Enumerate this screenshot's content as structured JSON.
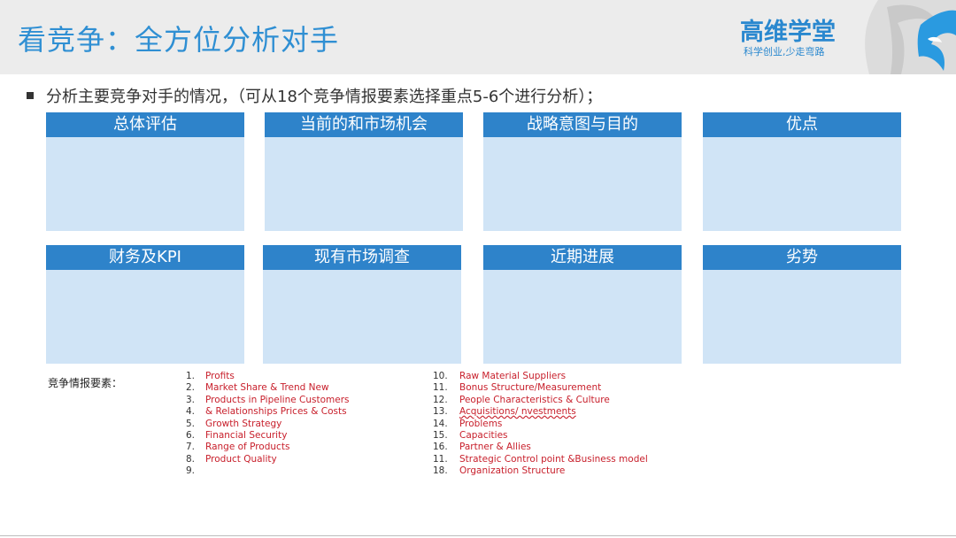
{
  "header": {
    "title": "看竞争：全方位分析对手",
    "brand": "高维学堂",
    "brand_tagline": "科学创业,少走弯路"
  },
  "intro": "分析主要竞争对手的情况，（可从18个竞争情报要素选择重点5-6个进行分析）；",
  "cards": [
    {
      "label": "总体评估"
    },
    {
      "label": "当前的和市场机会"
    },
    {
      "label": "战略意图与目的"
    },
    {
      "label": "优点"
    },
    {
      "label": "财务及KPI"
    },
    {
      "label": "现有市场调查"
    },
    {
      "label": "近期进展"
    },
    {
      "label": "劣势"
    }
  ],
  "factors": {
    "label": "竞争情报要素：",
    "column1": [
      {
        "num": "1.",
        "text": "Profits"
      },
      {
        "num": "2.",
        "text": "Market Share & Trend  New"
      },
      {
        "num": "3.",
        "text": "Products in Pipeline  Customers"
      },
      {
        "num": "4.",
        "text": "& Relationships  Prices & Costs"
      },
      {
        "num": "5.",
        "text": "Growth Strategy"
      },
      {
        "num": "6.",
        "text": "Financial Security"
      },
      {
        "num": "7.",
        "text": "Range of Products"
      },
      {
        "num": "8.",
        "text": "Product Quality"
      },
      {
        "num": "9.",
        "text": ""
      }
    ],
    "column2": [
      {
        "num": "10.",
        "text": "Raw Material Suppliers"
      },
      {
        "num": "11.",
        "text": "Bonus Structure/Measurement"
      },
      {
        "num": "12.",
        "text": "People Characteristics & Culture"
      },
      {
        "num": "13.",
        "text": "Acquisitions/ nvestments"
      },
      {
        "num": "14.",
        "text": "Problems"
      },
      {
        "num": "15.",
        "text": "Capacities"
      },
      {
        "num": "16.",
        "text": "Partner & Allies"
      },
      {
        "num": "11.",
        "text": "Strategic Control point &Business model"
      },
      {
        "num": "18.",
        "text": "Organization Structure"
      }
    ]
  },
  "colors": {
    "header_bg": "#ececec",
    "title": "#2f8fd3",
    "card_head": "#2e83ca",
    "card_body": "#d0e4f6",
    "factor_text": "#c8202c"
  }
}
